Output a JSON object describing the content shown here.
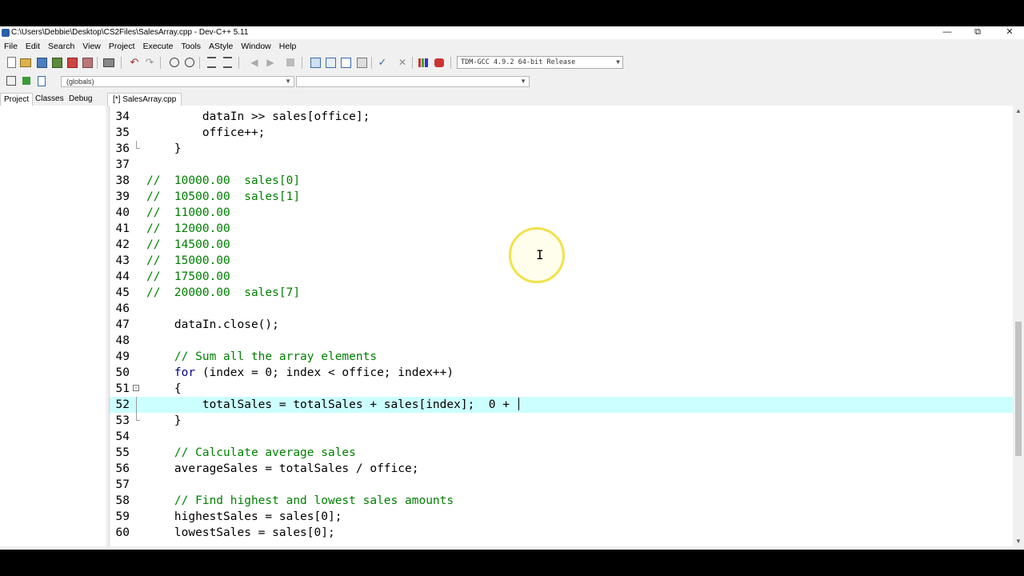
{
  "window": {
    "title": "C:\\Users\\Debbie\\Desktop\\CS2Files\\SalesArray.cpp - Dev-C++ 5.11",
    "minimize": "—",
    "restore": "⧉",
    "close": "✕"
  },
  "menu": [
    "File",
    "Edit",
    "Search",
    "View",
    "Project",
    "Execute",
    "Tools",
    "AStyle",
    "Window",
    "Help"
  ],
  "toolbar": {
    "compiler": "TDM-GCC 4.9.2 64-bit Release",
    "scope": "(globals)",
    "member": ""
  },
  "panel_tabs": [
    "Project",
    "Classes",
    "Debug"
  ],
  "file_tab": "[*] SalesArray.cpp",
  "colors": {
    "comment": "#008000",
    "keyword": "#000080",
    "active_line": "#ccffff"
  },
  "editor": {
    "lines": [
      {
        "num": "34",
        "text": "        dataIn >> sales[office];",
        "type": "code"
      },
      {
        "num": "35",
        "text": "        office++;",
        "type": "code"
      },
      {
        "num": "36",
        "text": "    }",
        "type": "code",
        "fold": "end"
      },
      {
        "num": "37",
        "text": "",
        "type": "code"
      },
      {
        "num": "38",
        "text": "//  10000.00  sales[0]",
        "type": "comment"
      },
      {
        "num": "39",
        "text": "//  10500.00  sales[1]",
        "type": "comment"
      },
      {
        "num": "40",
        "text": "//  11000.00",
        "type": "comment"
      },
      {
        "num": "41",
        "text": "//  12000.00",
        "type": "comment"
      },
      {
        "num": "42",
        "text": "//  14500.00",
        "type": "comment"
      },
      {
        "num": "43",
        "text": "//  15000.00",
        "type": "comment"
      },
      {
        "num": "44",
        "text": "//  17500.00",
        "type": "comment"
      },
      {
        "num": "45",
        "text": "//  20000.00  sales[7]",
        "type": "comment"
      },
      {
        "num": "46",
        "text": "",
        "type": "code"
      },
      {
        "num": "47",
        "text": "    dataIn.close();",
        "type": "code"
      },
      {
        "num": "48",
        "text": "",
        "type": "code"
      },
      {
        "num": "49",
        "text": "    // Sum all the array elements",
        "type": "comment"
      },
      {
        "num": "50",
        "keyword": "    for",
        "text": " (index = 0; index < office; index++)",
        "type": "keyword"
      },
      {
        "num": "51",
        "text": "    {",
        "type": "code",
        "fold": "start"
      },
      {
        "num": "52",
        "text": "        totalSales = totalSales + sales[index];  0 + ",
        "type": "code",
        "active": true,
        "fold": "mid"
      },
      {
        "num": "53",
        "text": "    }",
        "type": "code",
        "fold": "end"
      },
      {
        "num": "54",
        "text": "",
        "type": "code"
      },
      {
        "num": "55",
        "text": "    // Calculate average sales",
        "type": "comment"
      },
      {
        "num": "56",
        "text": "    averageSales = totalSales / office;",
        "type": "code"
      },
      {
        "num": "57",
        "text": "",
        "type": "code"
      },
      {
        "num": "58",
        "text": "    // Find highest and lowest sales amounts",
        "type": "comment"
      },
      {
        "num": "59",
        "text": "    highestSales = sales[0];",
        "type": "code"
      },
      {
        "num": "60",
        "text": "    lowestSales = sales[0];",
        "type": "code"
      }
    ]
  }
}
